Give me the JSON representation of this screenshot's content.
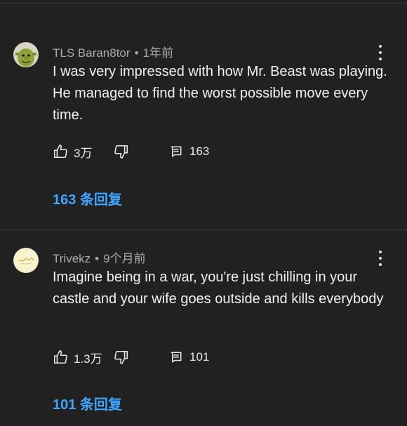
{
  "comments": [
    {
      "author": "TLS Baran8tor",
      "time": "1年前",
      "text": "I was very impressed with how Mr. Beast was playing. He managed to find the worst possible move every time.",
      "likes": "3万",
      "reply_count": "163",
      "replies_link": "163 条回复",
      "avatar_icon": "shrek-avatar"
    },
    {
      "author": "Trivekz",
      "time": "9个月前",
      "text": "Imagine being in a war, you're just chilling in your castle and your wife goes outside and kills everybody",
      "likes": "1.3万",
      "reply_count": "101",
      "replies_link": "101 条回复",
      "avatar_icon": "script-logo-avatar"
    }
  ],
  "meta_separator": "•",
  "colors": {
    "background": "#212121",
    "divider": "#3a3a3a",
    "text": "#f1f1f1",
    "meta": "#aaaaaa",
    "link": "#3ea6ff"
  }
}
